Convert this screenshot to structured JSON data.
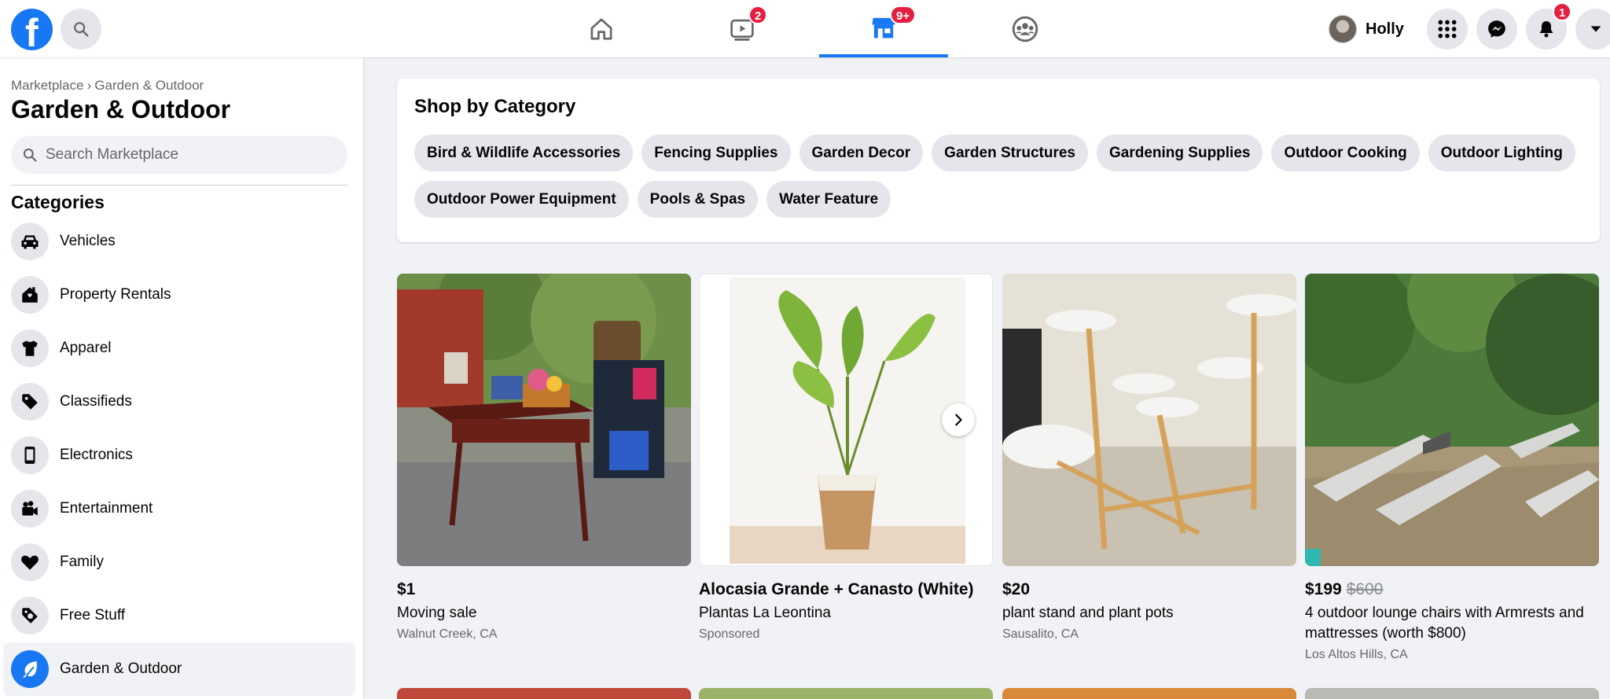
{
  "topbar": {
    "logo_letter": "f",
    "nav_badges": {
      "watch": "2",
      "marketplace": "9+"
    },
    "profile_name": "Holly",
    "notifications_badge": "1"
  },
  "sidebar": {
    "breadcrumb": [
      "Marketplace",
      "Garden & Outdoor"
    ],
    "breadcrumb_sep": "›",
    "title": "Garden & Outdoor",
    "search_placeholder": "Search Marketplace",
    "categories_heading": "Categories",
    "categories": [
      {
        "label": "Vehicles",
        "icon": "car-icon"
      },
      {
        "label": "Property Rentals",
        "icon": "house-icon"
      },
      {
        "label": "Apparel",
        "icon": "shirt-icon"
      },
      {
        "label": "Classifieds",
        "icon": "tag-icon"
      },
      {
        "label": "Electronics",
        "icon": "phone-icon"
      },
      {
        "label": "Entertainment",
        "icon": "camera-icon"
      },
      {
        "label": "Family",
        "icon": "heart-icon"
      },
      {
        "label": "Free Stuff",
        "icon": "free-tag-icon"
      },
      {
        "label": "Garden & Outdoor",
        "icon": "garden-icon",
        "active": true
      }
    ]
  },
  "shop_by_category": {
    "title": "Shop by Category",
    "chips": [
      "Bird & Wildlife Accessories",
      "Fencing Supplies",
      "Garden Decor",
      "Garden Structures",
      "Gardening Supplies",
      "Outdoor Cooking",
      "Outdoor Lighting",
      "Outdoor Power Equipment",
      "Pools & Spas",
      "Water Feature"
    ]
  },
  "listings": [
    {
      "price": "$1",
      "old_price": "",
      "title": "Moving sale",
      "location": "Walnut Creek, CA"
    },
    {
      "price": "Alocasia Grande + Canasto (White)",
      "old_price": "",
      "title": "Plantas La Leontina",
      "location": "Sponsored"
    },
    {
      "price": "$20",
      "old_price": "",
      "title": "plant stand and plant pots",
      "location": "Sausalito, CA"
    },
    {
      "price": "$199",
      "old_price": "$600",
      "title": "4 outdoor lounge chairs with Armrests and mattresses (worth $800)",
      "location": "Los Altos Hills, CA"
    }
  ],
  "colors": {
    "brand": "#1877f2",
    "badge": "#e41e3f",
    "page_bg": "#f0f2f5"
  }
}
